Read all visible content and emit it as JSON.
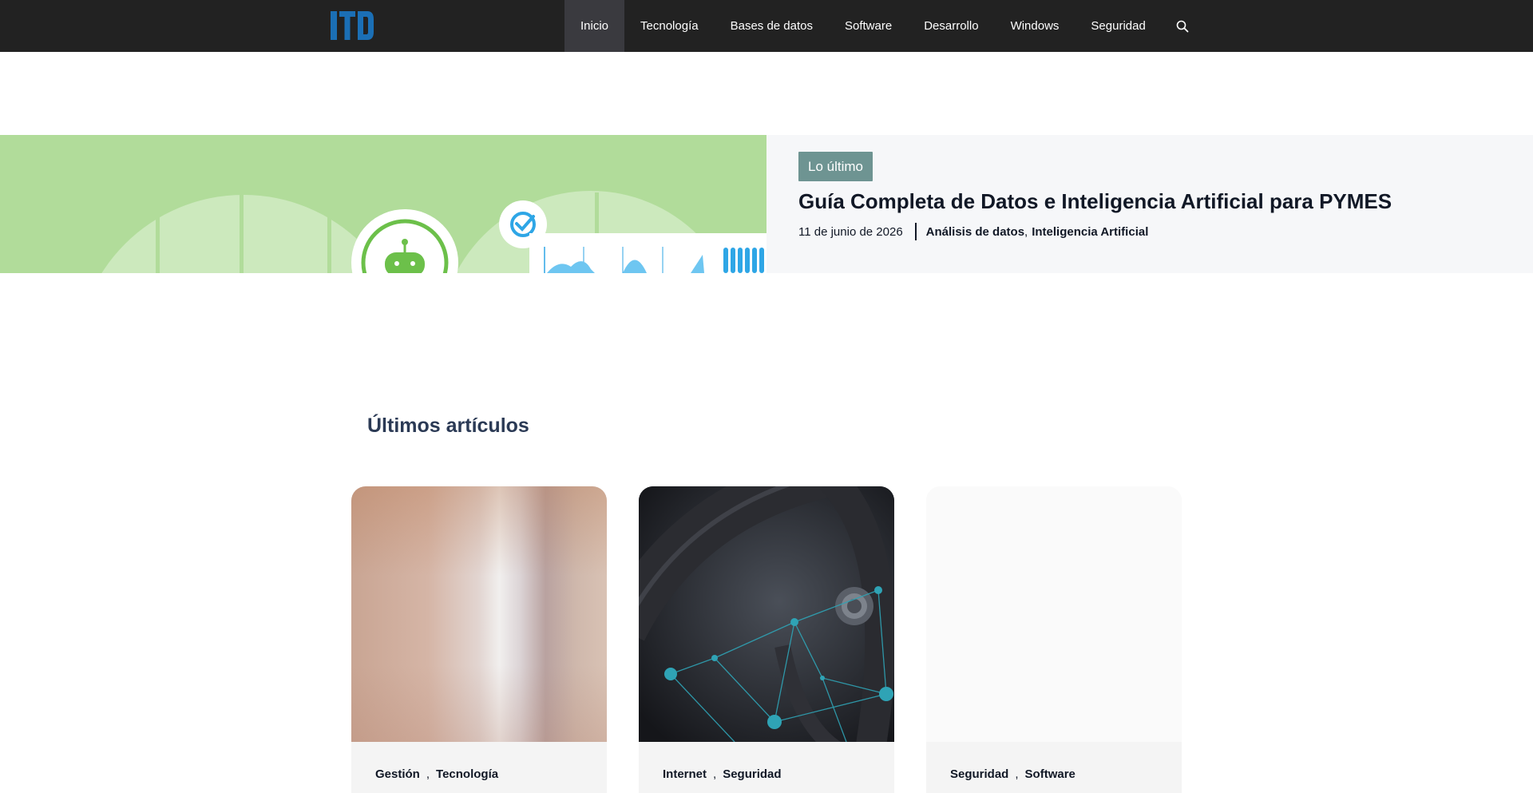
{
  "header": {
    "logo_text": "ITD",
    "nav": [
      {
        "label": "Inicio",
        "active": true
      },
      {
        "label": "Tecnología",
        "active": false
      },
      {
        "label": "Bases de datos",
        "active": false
      },
      {
        "label": "Software",
        "active": false
      },
      {
        "label": "Desarrollo",
        "active": false
      },
      {
        "label": "Windows",
        "active": false
      },
      {
        "label": "Seguridad",
        "active": false
      }
    ],
    "search_icon": "search-icon"
  },
  "hero": {
    "badge": "Lo último",
    "title": "Guía Completa de Datos e Inteligencia Artificial para PYMES",
    "date": "11 de junio de 2026",
    "categories": [
      "Análisis de datos",
      "Inteligencia Artificial"
    ]
  },
  "section": {
    "title": "Últimos artículos"
  },
  "cards": [
    {
      "categories": [
        "Gestión",
        "Tecnología"
      ]
    },
    {
      "categories": [
        "Internet",
        "Seguridad"
      ]
    },
    {
      "categories": [
        "Seguridad",
        "Software"
      ]
    }
  ],
  "colors": {
    "topbar": "#222222",
    "logo": "#1b6fb5",
    "badge": "#6e9492",
    "hero_green": "#b1dc9a",
    "heading": "#2b3a55"
  }
}
